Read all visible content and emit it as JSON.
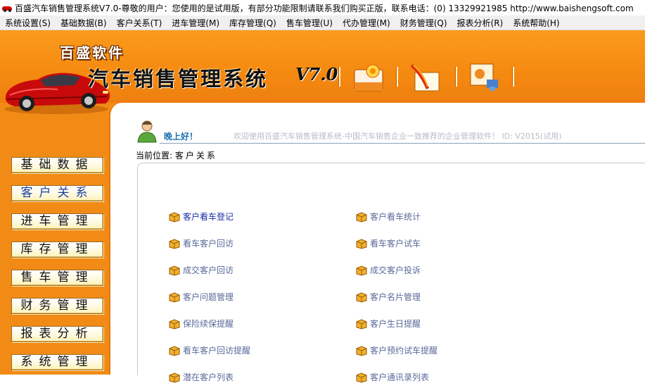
{
  "window": {
    "title": "百盛汽车销售管理系统V7.0-尊敬的用户：您使用的是试用版，有部分功能限制请联系我们购买正版，联系电话：(0) 13329921985  http://www.baishengsoft.com"
  },
  "menu": [
    "系统设置(S)",
    "基础数据(B)",
    "客户关系(T)",
    "进车管理(M)",
    "库存管理(Q)",
    "售车管理(U)",
    "代办管理(M)",
    "财务管理(Q)",
    "报表分析(R)",
    "系统帮助(H)"
  ],
  "banner": {
    "company": "百盛软件",
    "product": "汽车销售管理系统",
    "version": "V7.0"
  },
  "nav": [
    {
      "label": "基础数据",
      "active": false
    },
    {
      "label": "客户关系",
      "active": true
    },
    {
      "label": "进车管理",
      "active": false
    },
    {
      "label": "库存管理",
      "active": false
    },
    {
      "label": "售车管理",
      "active": false
    },
    {
      "label": "财务管理",
      "active": false
    },
    {
      "label": "报表分析",
      "active": false
    },
    {
      "label": "系统管理",
      "active": false
    }
  ],
  "greeting": {
    "hello": "晚上好！",
    "welcome": "欢迎使用百盛汽车销售管理系统-中国汽车销售企业一致推荐的企业管理软件！ ID: V2015(试用)"
  },
  "location": {
    "label": "当前位置:",
    "value": "客户关系"
  },
  "links": {
    "left": [
      "客户看车登记",
      "看车客户回访",
      "成交客户回访",
      "客户问题管理",
      "保险续保提醒",
      "看车客户回访提醒",
      "潜在客户列表"
    ],
    "right": [
      "客户看车统计",
      "看车客户试车",
      "成交客户投诉",
      "客户名片管理",
      "客户生日提醒",
      "客户预约试车提醒",
      "客户通讯录列表"
    ]
  },
  "colors": {
    "frame": "#f28b16",
    "link": "#5a6a9a",
    "link_first": "#1c2ea8",
    "active_nav": "#1a3fa0"
  }
}
